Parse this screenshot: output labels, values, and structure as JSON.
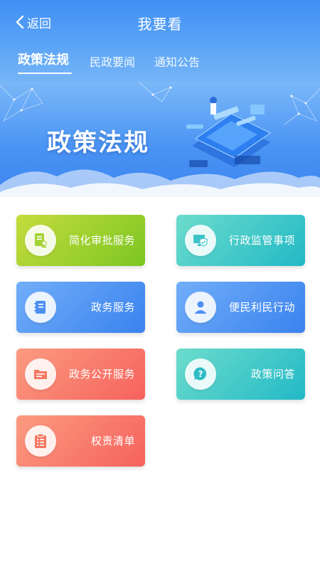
{
  "header": {
    "back_label": "返回",
    "title": "我要看"
  },
  "tabs": [
    {
      "label": "政策法规",
      "active": true
    },
    {
      "label": "民政要闻",
      "active": false
    },
    {
      "label": "通知公告",
      "active": false
    }
  ],
  "banner": {
    "title": "政策法规"
  },
  "services": [
    {
      "label": "简化审批服务",
      "icon": "document-user-icon",
      "color": "#8fcd2a"
    },
    {
      "label": "行政监管事项",
      "icon": "monitor-shield-icon",
      "color": "#35c0c8"
    },
    {
      "label": "政务服务",
      "icon": "notebook-icon",
      "color": "#4d8ff2"
    },
    {
      "label": "便民利民行动",
      "icon": "person-icon",
      "color": "#4d8ff2"
    },
    {
      "label": "政务公开服务",
      "icon": "folder-document-icon",
      "color": "#f76f63"
    },
    {
      "label": "政策问答",
      "icon": "question-bubble-icon",
      "color": "#26bac6"
    },
    {
      "label": "权责清单",
      "icon": "clipboard-list-icon",
      "color": "#f76f63"
    }
  ]
}
